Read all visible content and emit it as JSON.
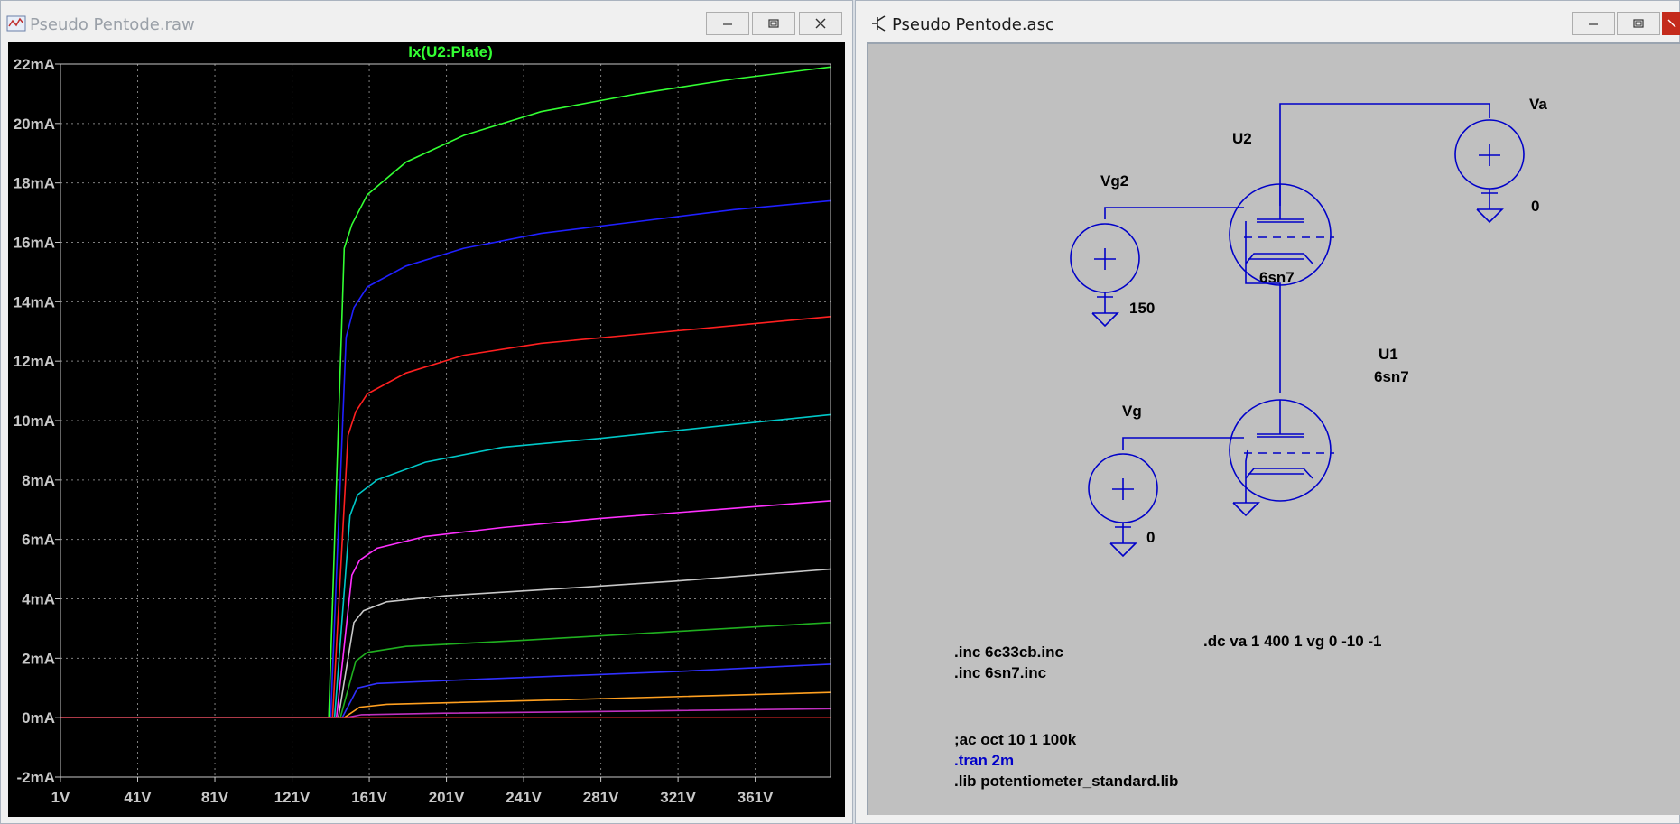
{
  "waveform_window": {
    "title": "Pseudo Pentode.raw",
    "buttons": [
      "minimize",
      "maximize",
      "close"
    ]
  },
  "schematic_window": {
    "title": "Pseudo Pentode.asc",
    "buttons": [
      "minimize",
      "maximize",
      "close"
    ]
  },
  "colors": {
    "plot_bg": "#000000",
    "grid": "#808080",
    "axis_text": "#c8c8c8",
    "trace_title": "#33ff33",
    "schematic_bg": "#c0c0c0",
    "wire": "#0000c8",
    "text": "#000000",
    "directive_blue": "#0000c8"
  },
  "chart_data": {
    "type": "line",
    "title": "Ix(U2:Plate)",
    "xlabel": "",
    "ylabel": "",
    "xlim": [
      1,
      400
    ],
    "ylim": [
      -2,
      22
    ],
    "x_ticks": [
      "1V",
      "41V",
      "81V",
      "121V",
      "161V",
      "201V",
      "241V",
      "281V",
      "321V",
      "361V"
    ],
    "x_tick_values": [
      1,
      41,
      81,
      121,
      161,
      201,
      241,
      281,
      321,
      361
    ],
    "y_ticks": [
      "-2mA",
      "0mA",
      "2mA",
      "4mA",
      "6mA",
      "8mA",
      "10mA",
      "12mA",
      "14mA",
      "16mA",
      "18mA",
      "20mA",
      "22mA"
    ],
    "y_tick_values": [
      -2,
      0,
      2,
      4,
      6,
      8,
      10,
      12,
      14,
      16,
      18,
      20,
      22
    ],
    "grid": true,
    "series": [
      {
        "color": "#33ff33",
        "x": [
          1,
          140,
          148,
          152,
          160,
          180,
          210,
          250,
          300,
          350,
          400
        ],
        "values": [
          0,
          0,
          15.8,
          16.6,
          17.6,
          18.7,
          19.6,
          20.4,
          21.0,
          21.5,
          21.9
        ]
      },
      {
        "color": "#2020ff",
        "x": [
          1,
          141,
          149,
          153,
          160,
          180,
          210,
          250,
          300,
          350,
          400
        ],
        "values": [
          0,
          0,
          12.8,
          13.8,
          14.5,
          15.2,
          15.8,
          16.3,
          16.7,
          17.1,
          17.4
        ]
      },
      {
        "color": "#ff2020",
        "x": [
          1,
          142,
          150,
          154,
          160,
          180,
          210,
          250,
          300,
          350,
          400
        ],
        "values": [
          0,
          0,
          9.5,
          10.3,
          10.9,
          11.6,
          12.2,
          12.6,
          12.9,
          13.2,
          13.5
        ]
      },
      {
        "color": "#00c8c8",
        "x": [
          1,
          143,
          151,
          155,
          165,
          190,
          230,
          280,
          340,
          400
        ],
        "values": [
          0,
          0,
          6.8,
          7.5,
          8.0,
          8.6,
          9.1,
          9.4,
          9.8,
          10.2
        ]
      },
      {
        "color": "#ff30ff",
        "x": [
          1,
          144,
          152,
          156,
          165,
          190,
          230,
          280,
          340,
          400
        ],
        "values": [
          0,
          0,
          4.8,
          5.3,
          5.7,
          6.1,
          6.4,
          6.7,
          7.0,
          7.3
        ]
      },
      {
        "color": "#c8c8c8",
        "x": [
          1,
          145,
          153,
          158,
          170,
          200,
          250,
          320,
          400
        ],
        "values": [
          0,
          0,
          3.2,
          3.6,
          3.9,
          4.1,
          4.3,
          4.6,
          5.0
        ]
      },
      {
        "color": "#20b020",
        "x": [
          1,
          146,
          154,
          160,
          180,
          240,
          320,
          400
        ],
        "values": [
          0,
          0,
          1.9,
          2.2,
          2.4,
          2.6,
          2.9,
          3.2
        ]
      },
      {
        "color": "#3030ff",
        "x": [
          1,
          147,
          155,
          165,
          220,
          320,
          400
        ],
        "values": [
          0,
          0,
          1.0,
          1.15,
          1.3,
          1.55,
          1.8
        ]
      },
      {
        "color": "#ffa020",
        "x": [
          1,
          148,
          156,
          170,
          260,
          400
        ],
        "values": [
          0,
          0,
          0.35,
          0.45,
          0.6,
          0.85
        ]
      },
      {
        "color": "#c030c0",
        "x": [
          1,
          149,
          157,
          200,
          300,
          400
        ],
        "values": [
          0,
          0,
          0.1,
          0.15,
          0.22,
          0.3
        ]
      },
      {
        "color": "#c02020",
        "x": [
          1,
          150,
          400
        ],
        "values": [
          0,
          0,
          0
        ]
      }
    ]
  },
  "schematic": {
    "components": {
      "u2_ref": "U2",
      "u2_value": "6sn7",
      "u1_ref": "U1",
      "u1_value": "6sn7",
      "vg2_ref": "Vg2",
      "vg2_value": "150",
      "vg_ref": "Vg",
      "vg_value": "0",
      "va_ref": "Va",
      "va_value": "0"
    },
    "directives": [
      {
        "text": ".inc 6c33cb.inc",
        "color": "#000000"
      },
      {
        "text": ".inc 6sn7.inc",
        "color": "#000000"
      },
      {
        "text": ".dc va 1 400 1 vg 0 -10 -1",
        "color": "#000000"
      },
      {
        "text": ";ac oct 10 1 100k",
        "color": "#000000"
      },
      {
        "text": ".tran 2m",
        "color": "#0000c8"
      },
      {
        "text": ".lib potentiometer_standard.lib",
        "color": "#000000"
      }
    ]
  }
}
